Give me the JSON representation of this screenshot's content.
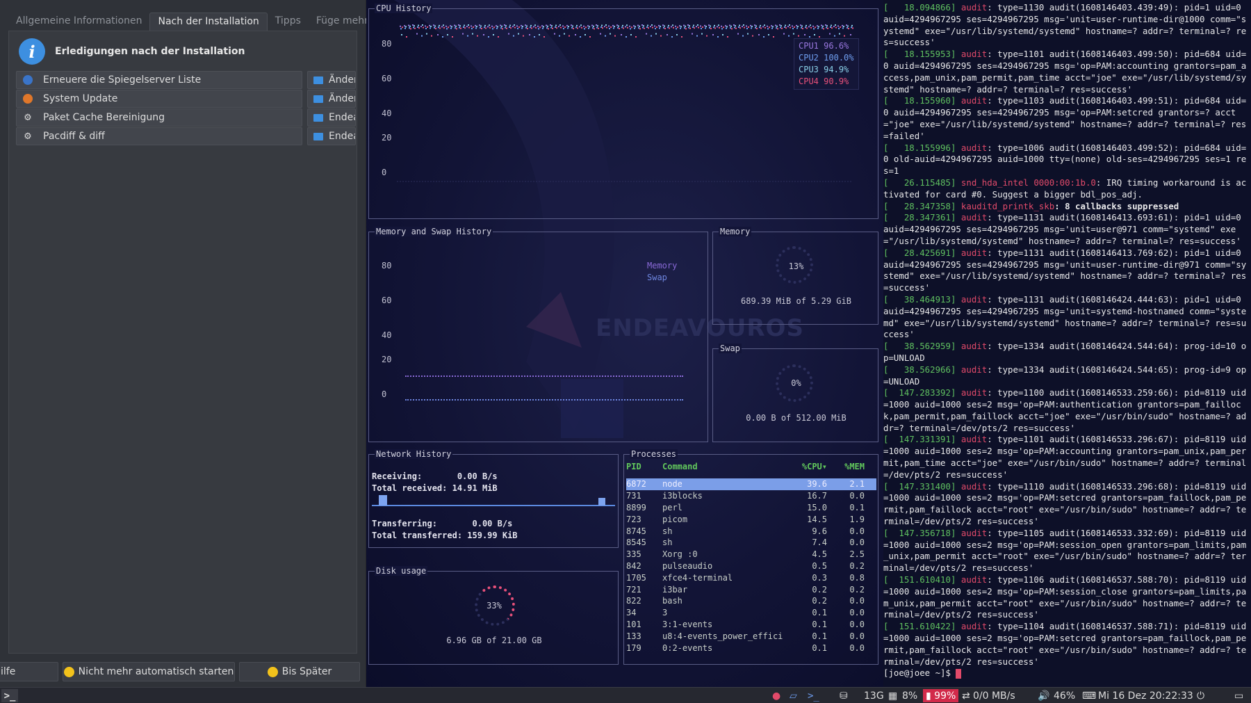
{
  "welcome": {
    "tabs": [
      "Allgemeine Informationen",
      "Nach der Installation",
      "Tipps",
      "Füge mehr Pro"
    ],
    "header": "Erledigungen nach der Installation",
    "actions": [
      {
        "label": "Erneuere die Spiegelserver Liste",
        "side": "Änder",
        "icon": "globe-icon"
      },
      {
        "label": "System Update",
        "side": "Änder",
        "icon": "update-icon"
      },
      {
        "label": "Paket Cache Bereinigung",
        "side": "Endea",
        "icon": "gear-icon"
      },
      {
        "label": "Pacdiff & diff",
        "side": "Endea",
        "icon": "gear-icon"
      }
    ],
    "buttons": {
      "help": "ilfe",
      "no_autostart": "Nicht mehr automatisch starten",
      "later": "Bis Später"
    }
  },
  "monitor": {
    "cpu": {
      "title": "CPU History",
      "y_ticks": [
        "80",
        "60",
        "40",
        "20",
        "0"
      ],
      "legend": [
        {
          "name": "CPU1",
          "value": "96.6%",
          "color": "#9a78e0"
        },
        {
          "name": "CPU2",
          "value": "100.0%",
          "color": "#6f9ef0"
        },
        {
          "name": "CPU3",
          "value": "94.9%",
          "color": "#8ad0e8"
        },
        {
          "name": "CPU4",
          "value": "90.9%",
          "color": "#e8507a"
        }
      ]
    },
    "memswap": {
      "title": "Memory and Swap History",
      "y_ticks": [
        "80",
        "60",
        "40",
        "20",
        "0"
      ],
      "legend": [
        "Memory",
        "Swap"
      ]
    },
    "memory": {
      "title": "Memory",
      "percent": "13%",
      "detail": "689.39 MiB of 5.29 GiB"
    },
    "swap": {
      "title": "Swap",
      "percent": "0%",
      "detail": "0.00 B of 512.00 MiB"
    },
    "network": {
      "title": "Network History",
      "receiving_label": "Receiving:",
      "receiving": "0.00 B/s",
      "total_received_label": "Total received:",
      "total_received": "14.91 MiB",
      "transferring_label": "Transferring:",
      "transferring": "0.00 B/s",
      "total_transferred_label": "Total transferred:",
      "total_transferred": "159.99 KiB"
    },
    "disk": {
      "title": "Disk usage",
      "percent": "33%",
      "detail": "6.96 GB of 21.00 GB"
    },
    "processes": {
      "title": "Processes",
      "headers": [
        "PID",
        "Command",
        "%CPU▾",
        "%MEM"
      ],
      "rows": [
        [
          "6872",
          "node",
          "39.6",
          "2.1"
        ],
        [
          "731",
          "i3blocks",
          "16.7",
          "0.0"
        ],
        [
          "8899",
          "perl",
          "15.0",
          "0.1"
        ],
        [
          "723",
          "picom",
          "14.5",
          "1.9"
        ],
        [
          "8745",
          "sh",
          "9.6",
          "0.0"
        ],
        [
          "8545",
          "sh",
          "7.4",
          "0.0"
        ],
        [
          "335",
          "Xorg :0",
          "4.5",
          "2.5"
        ],
        [
          "842",
          "pulseaudio",
          "0.5",
          "0.2"
        ],
        [
          "1705",
          "xfce4-terminal",
          "0.3",
          "0.8"
        ],
        [
          "721",
          "i3bar",
          "0.2",
          "0.2"
        ],
        [
          "822",
          "bash",
          "0.2",
          "0.0"
        ],
        [
          "34",
          "3",
          "0.1",
          "0.0"
        ],
        [
          "101",
          "3:1-events",
          "0.1",
          "0.0"
        ],
        [
          "133",
          "u8:4-events_power_effici",
          "0.1",
          "0.0"
        ],
        [
          "179",
          "0:2-events",
          "0.1",
          "0.0"
        ]
      ]
    },
    "watermark": "ENDEAVOUROS"
  },
  "terminal": {
    "lines": [
      {
        "ts": "[   18.094866]",
        "tag": "audit",
        "text": ": type=1130 audit(1608146403.439:49): pid=1 uid=0 auid=4294967295 ses=4294967295 msg='unit=user-runtime-dir@1000 comm=\"systemd\" exe=\"/usr/lib/systemd/systemd\" hostname=? addr=? terminal=? res=success'"
      },
      {
        "ts": "[   18.155953]",
        "tag": "audit",
        "text": ": type=1101 audit(1608146403.499:50): pid=684 uid=0 auid=4294967295 ses=4294967295 msg='op=PAM:accounting grantors=pam_access,pam_unix,pam_permit,pam_time acct=\"joe\" exe=\"/usr/lib/systemd/systemd\" hostname=? addr=? terminal=? res=success'"
      },
      {
        "ts": "[   18.155960]",
        "tag": "audit",
        "text": ": type=1103 audit(1608146403.499:51): pid=684 uid=0 auid=4294967295 ses=4294967295 msg='op=PAM:setcred grantors=? acct=\"joe\" exe=\"/usr/lib/systemd/systemd\" hostname=? addr=? terminal=? res=failed'"
      },
      {
        "ts": "[   18.155996]",
        "tag": "audit",
        "text": ": type=1006 audit(1608146403.499:52): pid=684 uid=0 old-auid=4294967295 auid=1000 tty=(none) old-ses=4294967295 ses=1 res=1"
      },
      {
        "ts": "[   26.115485]",
        "tag": "snd_hda_intel 0000:00:1b.0",
        "text": ": IRQ timing workaround is activated for card #0. Suggest a bigger bdl_pos_adj."
      },
      {
        "ts": "[   28.347358]",
        "tag": "kauditd_printk_skb",
        "text": ": 8 callbacks suppressed",
        "bold": true
      },
      {
        "ts": "[   28.347361]",
        "tag": "audit",
        "text": ": type=1131 audit(1608146413.693:61): pid=1 uid=0 auid=4294967295 ses=4294967295 msg='unit=user@971 comm=\"systemd\" exe=\"/usr/lib/systemd/systemd\" hostname=? addr=? terminal=? res=success'"
      },
      {
        "ts": "[   28.425691]",
        "tag": "audit",
        "text": ": type=1131 audit(1608146413.769:62): pid=1 uid=0 auid=4294967295 ses=4294967295 msg='unit=user-runtime-dir@971 comm=\"systemd\" exe=\"/usr/lib/systemd/systemd\" hostname=? addr=? terminal=? res=success'"
      },
      {
        "ts": "[   38.464913]",
        "tag": "audit",
        "text": ": type=1131 audit(1608146424.444:63): pid=1 uid=0 auid=4294967295 ses=4294967295 msg='unit=systemd-hostnamed comm=\"systemd\" exe=\"/usr/lib/systemd/systemd\" hostname=? addr=? terminal=? res=success'"
      },
      {
        "ts": "[   38.562959]",
        "tag": "audit",
        "text": ": type=1334 audit(1608146424.544:64): prog-id=10 op=UNLOAD"
      },
      {
        "ts": "[   38.562966]",
        "tag": "audit",
        "text": ": type=1334 audit(1608146424.544:65): prog-id=9 op=UNLOAD"
      },
      {
        "ts": "[  147.283392]",
        "tag": "audit",
        "text": ": type=1100 audit(1608146533.259:66): pid=8119 uid=1000 auid=1000 ses=2 msg='op=PAM:authentication grantors=pam_faillock,pam_permit,pam_faillock acct=\"joe\" exe=\"/usr/bin/sudo\" hostname=? addr=? terminal=/dev/pts/2 res=success'"
      },
      {
        "ts": "[  147.331391]",
        "tag": "audit",
        "text": ": type=1101 audit(1608146533.296:67): pid=8119 uid=1000 auid=1000 ses=2 msg='op=PAM:accounting grantors=pam_unix,pam_permit,pam_time acct=\"joe\" exe=\"/usr/bin/sudo\" hostname=? addr=? terminal=/dev/pts/2 res=success'"
      },
      {
        "ts": "[  147.331400]",
        "tag": "audit",
        "text": ": type=1110 audit(1608146533.296:68): pid=8119 uid=1000 auid=1000 ses=2 msg='op=PAM:setcred grantors=pam_faillock,pam_permit,pam_faillock acct=\"root\" exe=\"/usr/bin/sudo\" hostname=? addr=? terminal=/dev/pts/2 res=success'"
      },
      {
        "ts": "[  147.356718]",
        "tag": "audit",
        "text": ": type=1105 audit(1608146533.332:69): pid=8119 uid=1000 auid=1000 ses=2 msg='op=PAM:session_open grantors=pam_limits,pam_unix,pam_permit acct=\"root\" exe=\"/usr/bin/sudo\" hostname=? addr=? terminal=/dev/pts/2 res=success'"
      },
      {
        "ts": "[  151.610410]",
        "tag": "audit",
        "text": ": type=1106 audit(1608146537.588:70): pid=8119 uid=1000 auid=1000 ses=2 msg='op=PAM:session_close grantors=pam_limits,pam_unix,pam_permit acct=\"root\" exe=\"/usr/bin/sudo\" hostname=? addr=? terminal=/dev/pts/2 res=success'"
      },
      {
        "ts": "[  151.610422]",
        "tag": "audit",
        "text": ": type=1104 audit(1608146537.588:71): pid=8119 uid=1000 auid=1000 ses=2 msg='op=PAM:setcred grantors=pam_faillock,pam_permit,pam_faillock acct=\"root\" exe=\"/usr/bin/sudo\" hostname=? addr=? terminal=/dev/pts/2 res=success'"
      }
    ],
    "prompt": "[joe@joee ~]$ "
  },
  "taskbar": {
    "disk": "13G",
    "cpu": "8%",
    "battery": "99%",
    "network": "0/0 MB/s",
    "volume": "46%",
    "datetime": "Mi 16 Dez 20:22:33"
  }
}
